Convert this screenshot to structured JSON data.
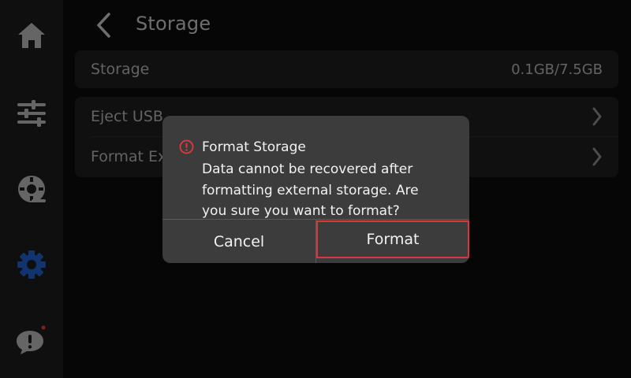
{
  "sidebar": {
    "items": [
      {
        "icon": "home-icon",
        "active": false
      },
      {
        "icon": "sliders-icon",
        "active": false
      },
      {
        "icon": "filament-icon",
        "active": false
      },
      {
        "icon": "gear-icon",
        "active": true
      },
      {
        "icon": "alert-icon",
        "active": false,
        "notification_dot": true
      }
    ],
    "colors": {
      "inactive": "#b9b9b9",
      "active": "#1f5fc9",
      "dot": "#e0393e"
    }
  },
  "header": {
    "title": "Storage",
    "back_icon": "chevron-left-icon"
  },
  "storage": {
    "label": "Storage",
    "value": "0.1GB/7.5GB"
  },
  "list": {
    "items": [
      {
        "label": "Eject USB",
        "icon": "chevron-right-icon"
      },
      {
        "label": "Format Ex",
        "icon": "chevron-right-icon"
      }
    ]
  },
  "dialog": {
    "icon": "warning-circle-icon",
    "title": "Format Storage",
    "message": "Data cannot be recovered after formatting external storage. Are you sure you want to format?",
    "cancel_label": "Cancel",
    "confirm_label": "Format",
    "colors": {
      "warning": "#e0393e",
      "focus_border": "#d9363e"
    }
  }
}
